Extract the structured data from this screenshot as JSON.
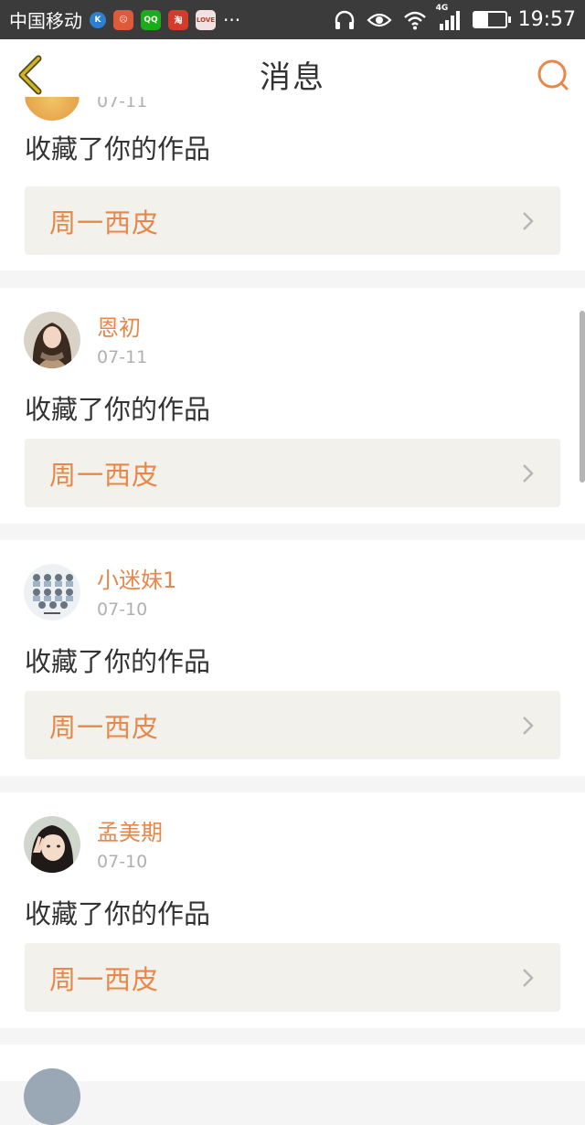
{
  "status_bar": {
    "carrier": "中国移动",
    "notifications": [
      {
        "icon": "k-app-icon",
        "text": "K",
        "color": "#2f7fd1"
      },
      {
        "icon": "sad-face-app-icon",
        "text": "☹",
        "color": "#e05a3a"
      },
      {
        "icon": "green-app-icon",
        "text": "QQ",
        "color": "#1aad19"
      },
      {
        "icon": "red-app-icon",
        "text": "淘",
        "color": "#d63a2a"
      },
      {
        "icon": "love-app-icon",
        "text": "LOVE",
        "color": "#c0392b"
      }
    ],
    "more": "···",
    "network": "4G",
    "time": "19:57",
    "battery_level": 0.45
  },
  "nav": {
    "title": "消息",
    "back_icon": "chevron-left-icon",
    "search_icon": "search-icon",
    "accent": "#e8874a",
    "back_color": "#d4b323"
  },
  "feed": {
    "partial_top": {
      "action": "收藏了你的作品",
      "work": "周一西皮"
    },
    "items": [
      {
        "name": "恩初",
        "date": "07-11",
        "action": "收藏了你的作品",
        "work": "周一西皮",
        "avatar": "girl-scarf"
      },
      {
        "name": "小迷妹1",
        "date": "07-10",
        "action": "收藏了你的作品",
        "work": "周一西皮",
        "avatar": "group-grid"
      },
      {
        "name": "孟美期",
        "date": "07-10",
        "action": "收藏了你的作品",
        "work": "周一西皮",
        "avatar": "girl-peace"
      }
    ]
  }
}
